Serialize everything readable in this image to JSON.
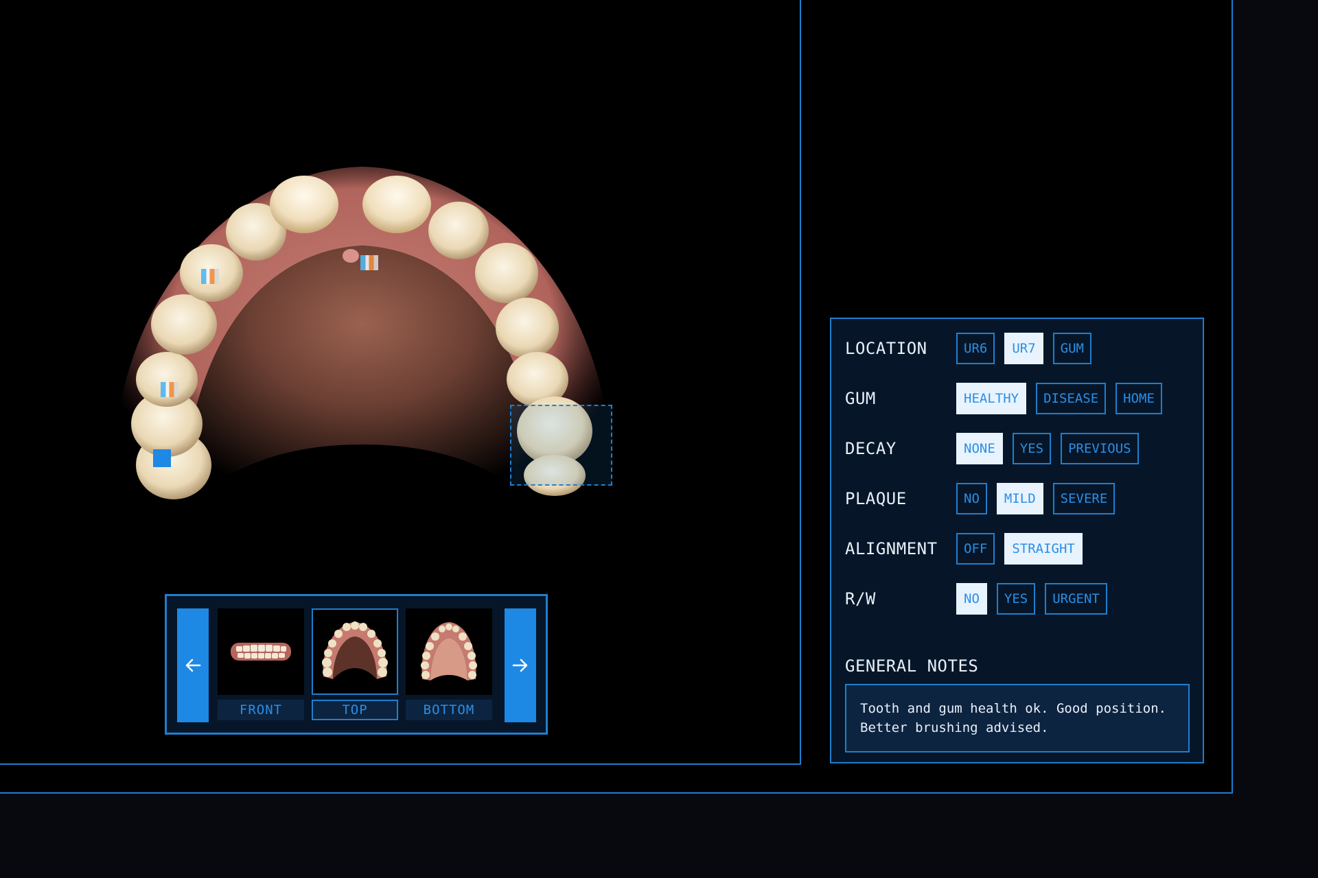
{
  "viewer": {
    "markers": [
      {
        "type": "stripe"
      },
      {
        "type": "stripe"
      },
      {
        "type": "stripe"
      },
      {
        "type": "square"
      }
    ]
  },
  "carousel": {
    "prev_icon": "arrow-left-icon",
    "next_icon": "arrow-right-icon",
    "views": [
      {
        "label": "FRONT",
        "active": false
      },
      {
        "label": "TOP",
        "active": true
      },
      {
        "label": "BOTTOM",
        "active": false
      }
    ]
  },
  "panel": {
    "rows": [
      {
        "label": "LOCATION",
        "options": [
          "UR6",
          "UR7",
          "GUM"
        ],
        "selected": "UR7"
      },
      {
        "label": "GUM",
        "options": [
          "HEALTHY",
          "DISEASE",
          "HOME"
        ],
        "selected": "HEALTHY"
      },
      {
        "label": "DECAY",
        "options": [
          "NONE",
          "YES",
          "PREVIOUS"
        ],
        "selected": "NONE"
      },
      {
        "label": "PLAQUE",
        "options": [
          "NO",
          "MILD",
          "SEVERE"
        ],
        "selected": "MILD"
      },
      {
        "label": "ALIGNMENT",
        "options": [
          "OFF",
          "STRAIGHT"
        ],
        "selected": "STRAIGHT"
      },
      {
        "label": "R/W",
        "options": [
          "NO",
          "YES",
          "URGENT"
        ],
        "selected": "NO"
      }
    ],
    "notes_title": "GENERAL NOTES",
    "notes_text": "Tooth and gum health ok. Good position. Better brushing advised."
  },
  "colors": {
    "accent": "#1f7fd0",
    "button_fill": "#1e88e5",
    "panel_bg": "#061628",
    "selected_bg": "#e8f3fd",
    "text_light": "#e9f0f8"
  }
}
